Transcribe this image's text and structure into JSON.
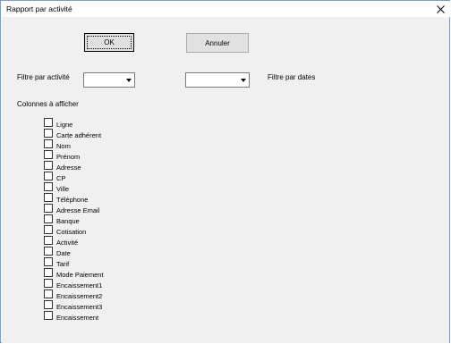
{
  "window": {
    "title": "Rapport par activité"
  },
  "buttons": {
    "ok_label": "OK",
    "cancel_label": "Annuler"
  },
  "filters": {
    "activity_label": "Filtre par activité",
    "activity_value": "",
    "dates_label": "Filtre par dates",
    "dates_value": ""
  },
  "columns": {
    "heading": "Colonnes à afficher",
    "items": [
      {
        "label": "Ligne",
        "checked": false
      },
      {
        "label": "Carte adhérent",
        "checked": false
      },
      {
        "label": "Nom",
        "checked": false
      },
      {
        "label": "Prénom",
        "checked": false
      },
      {
        "label": "Adresse",
        "checked": false
      },
      {
        "label": "CP",
        "checked": false
      },
      {
        "label": "Ville",
        "checked": false
      },
      {
        "label": "Téléphone",
        "checked": false
      },
      {
        "label": "Adresse Email",
        "checked": false
      },
      {
        "label": "Banque",
        "checked": false
      },
      {
        "label": "Cotisation",
        "checked": false
      },
      {
        "label": "Activité",
        "checked": false
      },
      {
        "label": "Date",
        "checked": false
      },
      {
        "label": "Tarif",
        "checked": false
      },
      {
        "label": "Mode Paiement",
        "checked": false
      },
      {
        "label": "Encaissement1",
        "checked": false
      },
      {
        "label": "Encaissement2",
        "checked": false
      },
      {
        "label": "Encaissement3",
        "checked": false
      },
      {
        "label": "Encaissement",
        "checked": false
      }
    ]
  },
  "icons": {
    "close": "close-icon",
    "dropdown": "chevron-down-icon"
  }
}
